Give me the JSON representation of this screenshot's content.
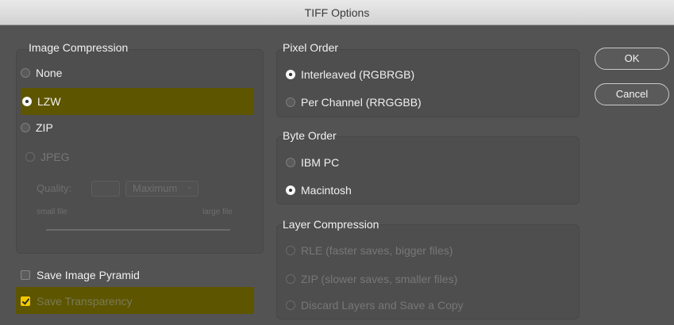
{
  "window": {
    "title": "TIFF Options"
  },
  "image_compression": {
    "legend": "Image Compression",
    "options": [
      {
        "label": "None",
        "selected": false,
        "enabled": true
      },
      {
        "label": "LZW",
        "selected": true,
        "enabled": true
      },
      {
        "label": "ZIP",
        "selected": false,
        "enabled": true
      },
      {
        "label": "JPEG",
        "selected": false,
        "enabled": false
      }
    ],
    "quality_label": "Quality:",
    "quality_value": "",
    "quality_preset": "Maximum",
    "slider_min_label": "small file",
    "slider_max_label": "large file"
  },
  "pixel_order": {
    "legend": "Pixel Order",
    "options": [
      {
        "label": "Interleaved (RGBRGB)",
        "selected": true
      },
      {
        "label": "Per Channel (RRGGBB)",
        "selected": false
      }
    ]
  },
  "byte_order": {
    "legend": "Byte Order",
    "options": [
      {
        "label": "IBM PC",
        "selected": false
      },
      {
        "label": "Macintosh",
        "selected": true
      }
    ]
  },
  "layer_compression": {
    "legend": "Layer Compression",
    "options": [
      {
        "label": "RLE (faster saves, bigger files)",
        "selected": false,
        "enabled": false
      },
      {
        "label": "ZIP (slower saves, smaller files)",
        "selected": false,
        "enabled": false
      },
      {
        "label": "Discard Layers and Save a Copy",
        "selected": false,
        "enabled": false
      }
    ]
  },
  "checkboxes": {
    "pyramid": {
      "label": "Save Image Pyramid",
      "checked": false
    },
    "transparency": {
      "label": "Save Transparency",
      "checked": true
    }
  },
  "buttons": {
    "ok": "OK",
    "cancel": "Cancel"
  },
  "colors": {
    "highlight": "#5e5500",
    "accent": "#f2c800",
    "background": "#535353"
  }
}
